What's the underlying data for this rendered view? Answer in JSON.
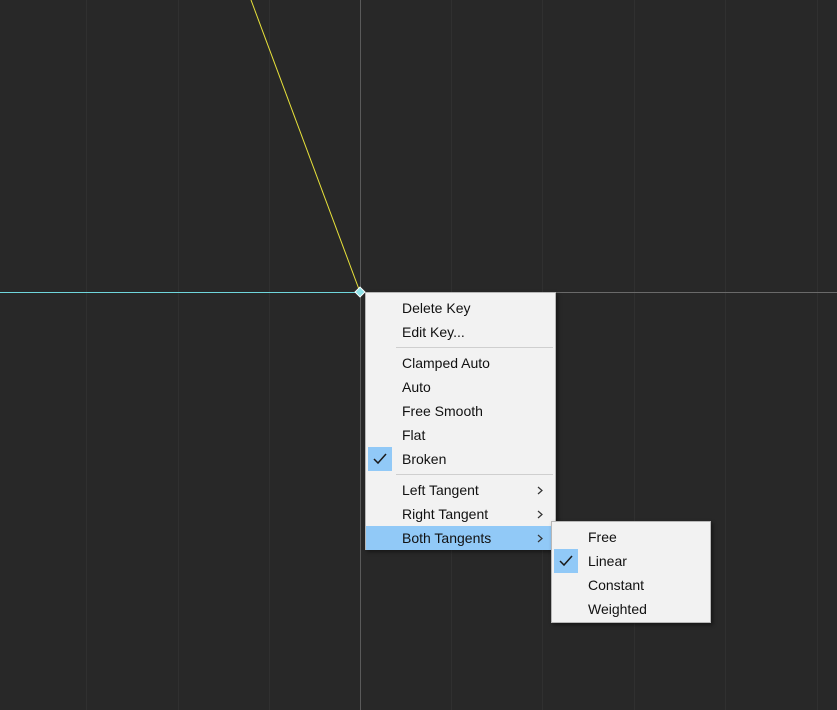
{
  "context_menu": {
    "items": [
      {
        "label": "Delete Key"
      },
      {
        "label": "Edit Key..."
      },
      {
        "label": "Clamped Auto"
      },
      {
        "label": "Auto"
      },
      {
        "label": "Free Smooth"
      },
      {
        "label": "Flat"
      },
      {
        "label": "Broken",
        "checked": true
      },
      {
        "label": "Left Tangent",
        "submenu": true
      },
      {
        "label": "Right Tangent",
        "submenu": true
      },
      {
        "label": "Both Tangents",
        "submenu": true,
        "highlighted": true
      }
    ]
  },
  "submenu": {
    "items": [
      {
        "label": "Free"
      },
      {
        "label": "Linear",
        "checked": true
      },
      {
        "label": "Constant"
      },
      {
        "label": "Weighted"
      }
    ]
  },
  "colors": {
    "background": "#282828",
    "grid_line": "#303030",
    "curve_yellow": "#e8e23a",
    "curve_cyan": "#6fd6dc",
    "highlight": "#91c9f7",
    "menu_bg": "#f2f2f2"
  },
  "icons": {
    "check": "check-icon",
    "submenu_arrow": "chevron-right-icon",
    "key": "keyframe-diamond-icon"
  }
}
